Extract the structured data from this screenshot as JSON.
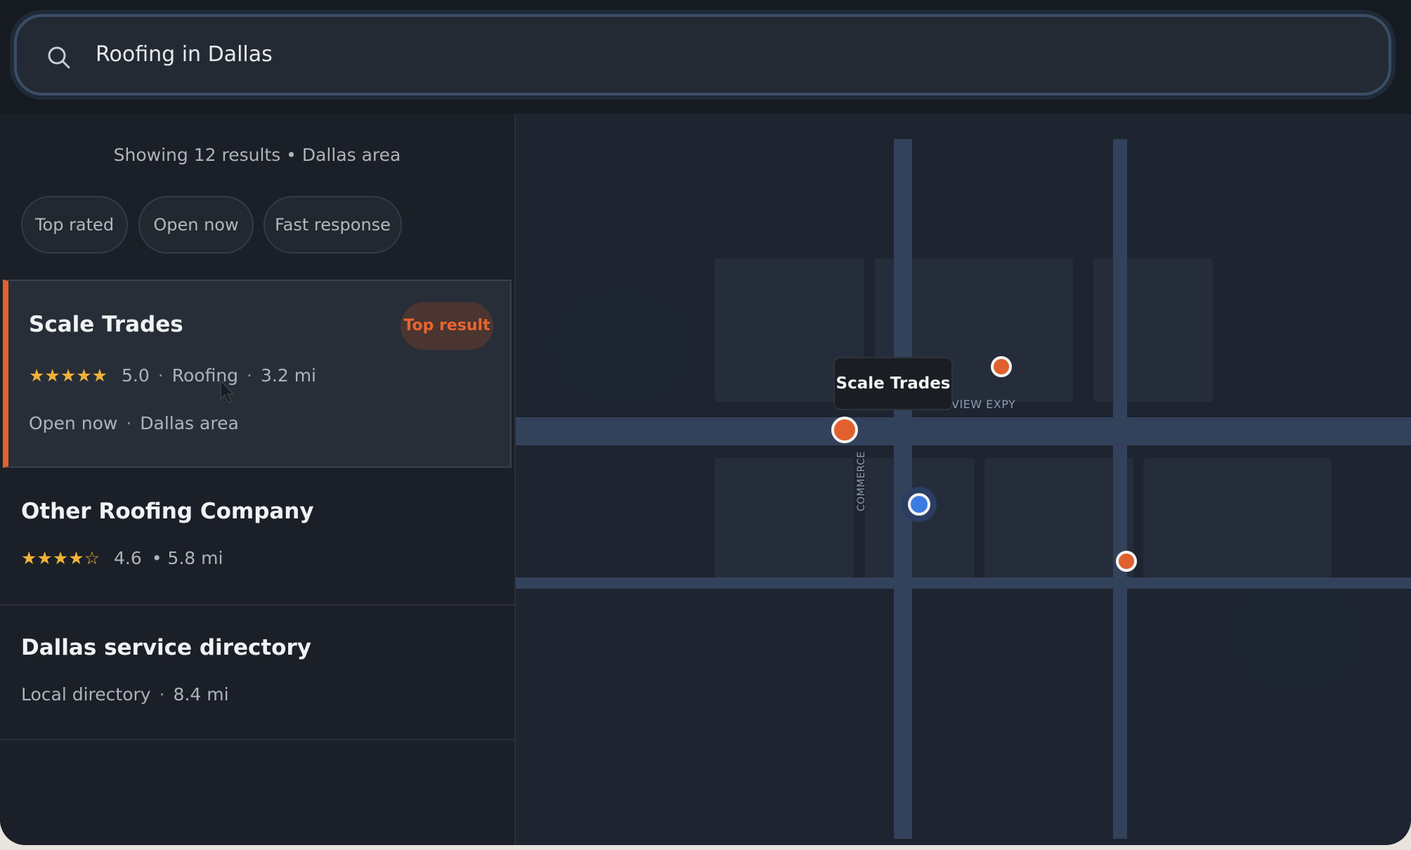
{
  "search": {
    "query": "Roofing in Dallas",
    "icon": "search-icon"
  },
  "results": {
    "summary": "Showing 12 results • Dallas area",
    "filters": [
      "Top rated",
      "Open now",
      "Fast response"
    ],
    "items": [
      {
        "title": "Scale Trades",
        "badge": "Top result",
        "stars": "★★★★★",
        "rating": "5.0",
        "category": "Roofing",
        "distance": "3.2 mi",
        "status": "Open now",
        "area": "Dallas area"
      },
      {
        "title": "Other Roofing Company",
        "stars": "★★★★☆",
        "rating": "4.6",
        "distance": "• 5.8 mi"
      },
      {
        "title": "Dallas service directory",
        "type": "Local directory",
        "distance": "8.4 mi"
      }
    ]
  },
  "map": {
    "tooltip": "Scale Trades",
    "road_horizontal": "VIEW EXPY",
    "road_vertical": "COMMERCE"
  },
  "colors": {
    "accent": "#e0612d",
    "user_location": "#3b7be0",
    "star": "#f0b23a"
  }
}
